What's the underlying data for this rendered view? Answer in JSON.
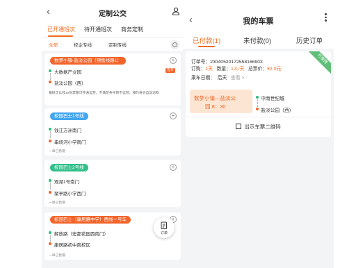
{
  "left_app": {
    "title": "定制公交",
    "back_icon": "chevron-left-icon",
    "user_icon": "user-icon",
    "tabs": [
      "已开通班次",
      "待开通班次",
      "商务定制"
    ],
    "filters": [
      "全部",
      "校企专线",
      "定制专线"
    ],
    "search_icon": "search-icon",
    "routes": [
      {
        "name": "数梦小镇-盐淡公园（预售线路1）",
        "color": "#f2642a",
        "stops": [
          "大数据产业园",
          "盐淡公园（西）"
        ],
        "tag": "暂开",
        "note": "每班次比较10张票都可开通运营，不满足条件则不运营，按时将会自动退款"
      },
      {
        "name": "校园巴士1号线",
        "color": "#43a6ee",
        "stops": [
          "钱江方洲南门",
          "串场河小学南门"
        ],
        "schedule": "一单已售罄"
      },
      {
        "name": "校园巴士2号线",
        "color": "#33bf8a",
        "stops": [
          "观湖1号南门",
          "聚亭路小学西门"
        ],
        "schedule": "一单已售罄"
      },
      {
        "name": "校园巴士（康居路中学）西线一号车",
        "color": "#f2642a",
        "stops": [
          "解放路（宏都花园西南门）",
          "康居路初中南校区"
        ],
        "schedule": "一单已售罄"
      }
    ],
    "fab_label": "订单",
    "fab_icon": "receipt-icon"
  },
  "right_app": {
    "title": "我的车票",
    "back_icon": "chevron-left-icon",
    "more_icon": "more-vertical-icon",
    "tabs": [
      "已付款(1)",
      "未付款(0)",
      "历史订单"
    ],
    "ticket": {
      "ribbon": "可使用",
      "order_label": "订单号：",
      "order_no": "2304052017255816690З",
      "order_no_clean": "23040520172558166903",
      "type_label": "订购：",
      "type_value": "1天",
      "qty_label": "数量：",
      "qty_value": "1人/天",
      "price_label": "总票价：",
      "price_value": "¥2.0元",
      "date_label": "乘车日期：",
      "date_value": "后天",
      "view_label": "查看 >",
      "route_name": "数梦小镇—盐淡公",
      "route_name2": "园 8：30",
      "from_stop": "中南世纪城",
      "to_stop": "盐淡公园（西）",
      "qr_label": "出示车票二维码",
      "qr_icon": "qr-code-icon"
    }
  }
}
